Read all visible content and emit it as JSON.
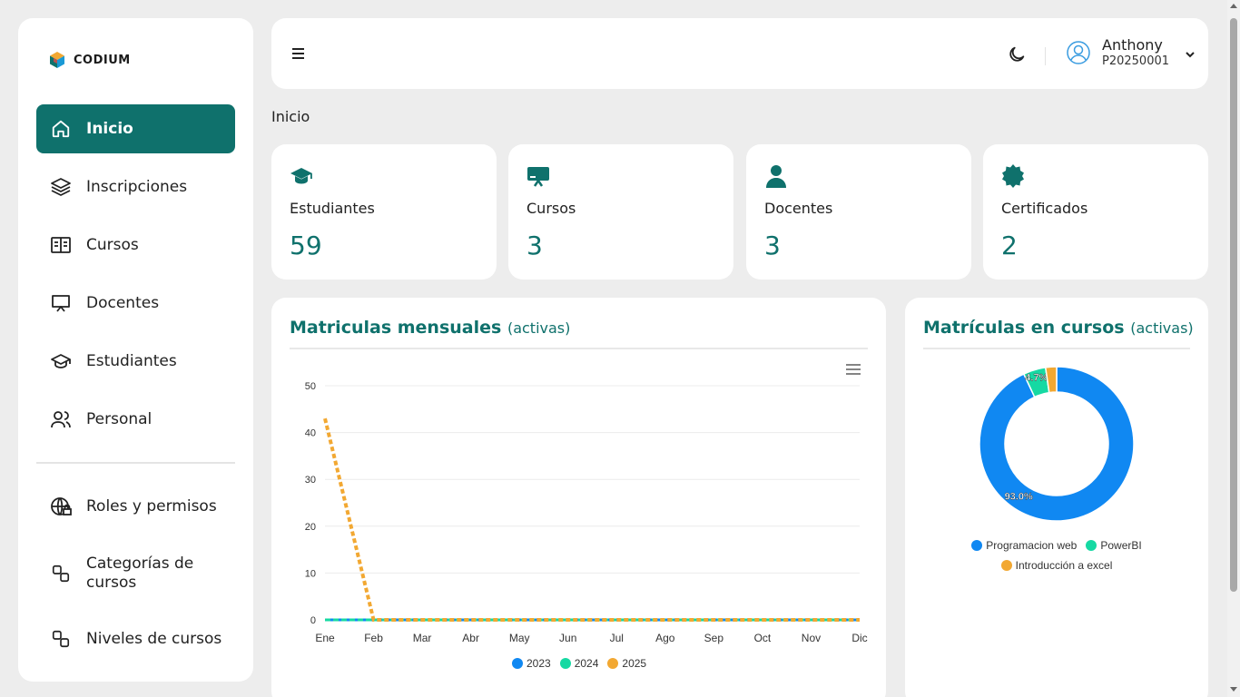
{
  "app": {
    "logo_text": "CODIUM"
  },
  "colors": {
    "primary": "#0f716c",
    "series_2023": "#1088f2",
    "series_2024": "#16d9a3",
    "series_2025": "#f2a832"
  },
  "sidebar": {
    "items": [
      {
        "label": "Inicio",
        "icon": "home-icon",
        "active": true
      },
      {
        "label": "Inscripciones",
        "icon": "layers-icon"
      },
      {
        "label": "Cursos",
        "icon": "book-open-icon"
      },
      {
        "label": "Docentes",
        "icon": "presentation-icon"
      },
      {
        "label": "Estudiantes",
        "icon": "graduation-cap-icon"
      },
      {
        "label": "Personal",
        "icon": "users-icon"
      },
      {
        "label": "Roles y permisos",
        "icon": "globe-lock-icon"
      },
      {
        "label": "Categorías de cursos",
        "icon": "boxes-icon"
      },
      {
        "label": "Niveles de cursos",
        "icon": "boxes-icon"
      }
    ]
  },
  "header": {
    "user_name": "Anthony",
    "user_code": "P20250001"
  },
  "page_title": "Inicio",
  "stats": [
    {
      "label": "Estudiantes",
      "value": "59",
      "icon": "graduation-cap-icon"
    },
    {
      "label": "Cursos",
      "value": "3",
      "icon": "easel-icon"
    },
    {
      "label": "Docentes",
      "value": "3",
      "icon": "person-icon"
    },
    {
      "label": "Certificados",
      "value": "2",
      "icon": "badge-icon"
    }
  ],
  "monthly_panel": {
    "title": "Matriculas mensuales",
    "subtitle": "(activas)"
  },
  "courses_panel": {
    "title": "Matrículas en cursos",
    "subtitle": "(activas)"
  },
  "chart_data": [
    {
      "type": "line",
      "categories": [
        "Ene",
        "Feb",
        "Mar",
        "Abr",
        "May",
        "Jun",
        "Jul",
        "Ago",
        "Sep",
        "Oct",
        "Nov",
        "Dic"
      ],
      "yticks": [
        0,
        10,
        20,
        30,
        40,
        50
      ],
      "ylim": [
        0,
        50
      ],
      "series": [
        {
          "name": "2023",
          "values": [
            0,
            0,
            0,
            0,
            0,
            0,
            0,
            0,
            0,
            0,
            0,
            0
          ]
        },
        {
          "name": "2024",
          "values": [
            0,
            0,
            0,
            0,
            0,
            0,
            0,
            0,
            0,
            0,
            0,
            0
          ]
        },
        {
          "name": "2025",
          "values": [
            43,
            0,
            0,
            0,
            0,
            0,
            0,
            0,
            0,
            0,
            0,
            0
          ]
        }
      ],
      "grid": true,
      "legend": "bottom"
    },
    {
      "type": "pie",
      "donut": true,
      "labels": [
        "Programacion web",
        "PowerBI",
        "Introducción a excel"
      ],
      "values": [
        93.0,
        4.7,
        2.3
      ],
      "data_labels": [
        "93.0%",
        "4.7%"
      ],
      "legend": "bottom"
    }
  ]
}
